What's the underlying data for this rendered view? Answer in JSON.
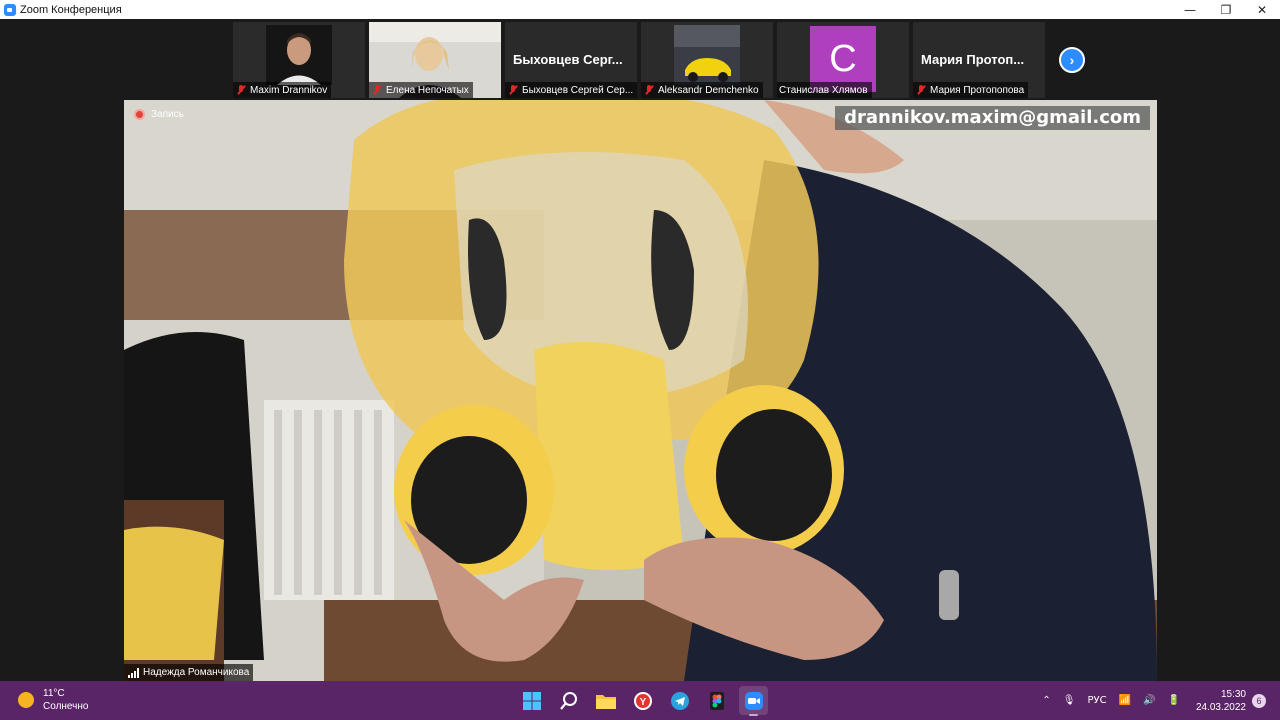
{
  "window": {
    "title": "Zoom Конференция",
    "controls": {
      "minimize": "—",
      "maximize": "❐",
      "close": "✕"
    }
  },
  "gallery": {
    "participants": [
      {
        "name": "Maxim Drannikov",
        "muted": true,
        "view": "video"
      },
      {
        "name": "Елена Непочатых",
        "muted": true,
        "view": "video",
        "active": true
      },
      {
        "name": "Быховцев Сергей Сер...",
        "display_name": "Быховцев Серг...",
        "muted": true,
        "view": "name"
      },
      {
        "name": "Aleksandr Demchenko",
        "muted": true,
        "view": "video"
      },
      {
        "name": "Станислав Хлямов",
        "muted": false,
        "view": "avatar",
        "avatar_letter": "C",
        "avatar_color": "#b03fc0"
      },
      {
        "name": "Мария Протопопова",
        "display_name": "Мария Протоп...",
        "muted": true,
        "view": "name"
      }
    ],
    "next_icon": "chevron-right-icon",
    "next_glyph": "›"
  },
  "main_video": {
    "recording_label": "Запись",
    "watermark_email": "drannikov.maxim@gmail.com",
    "speaker_name": "Надежда Романчикова"
  },
  "taskbar": {
    "weather": {
      "temp": "11°C",
      "condition": "Солнечно"
    },
    "apps": [
      "windows-start-icon",
      "search-icon",
      "file-explorer-icon",
      "yandex-browser-icon",
      "telegram-icon",
      "figma-icon",
      "zoom-icon"
    ],
    "tray": {
      "language": "РУС",
      "time": "15:30",
      "date": "24.03.2022",
      "notifications": "6"
    }
  },
  "colors": {
    "accent": "#2d8cff",
    "taskbar": "#5a2566",
    "muted": "#e02828"
  }
}
